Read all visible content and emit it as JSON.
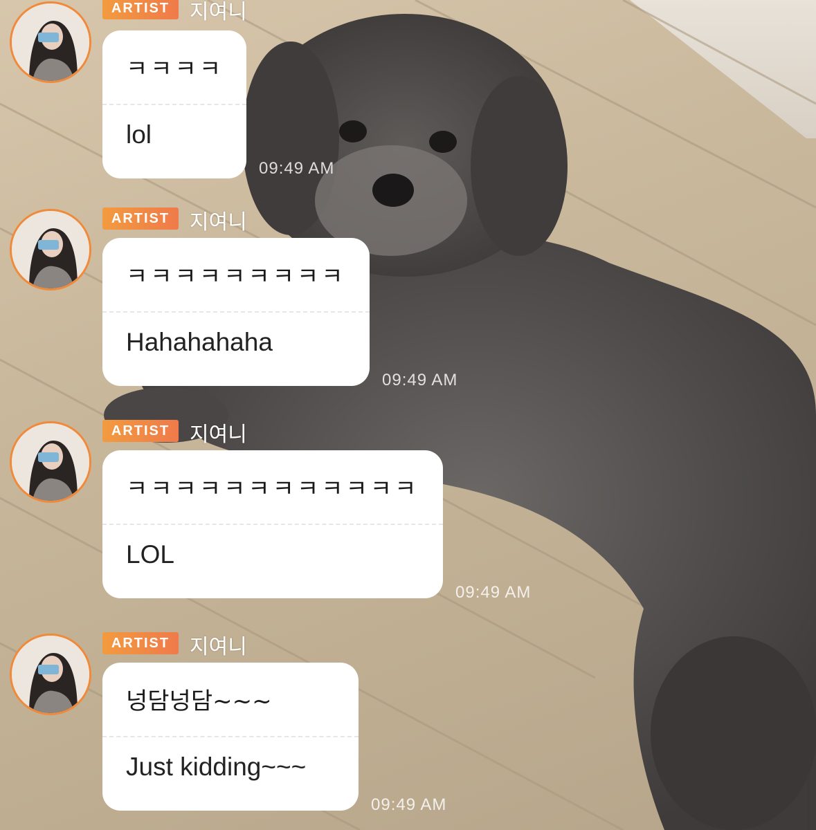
{
  "messages": [
    {
      "badge": "ARTIST",
      "sender": "지여니",
      "original": "ㅋㅋㅋㅋ",
      "translation": "lol",
      "time": "09:49 AM"
    },
    {
      "badge": "ARTIST",
      "sender": "지여니",
      "original": "ㅋㅋㅋㅋㅋㅋㅋㅋㅋ",
      "translation": "Hahahahaha",
      "time": "09:49 AM"
    },
    {
      "badge": "ARTIST",
      "sender": "지여니",
      "original": "ㅋㅋㅋㅋㅋㅋㅋㅋㅋㅋㅋㅋ",
      "translation": "LOL",
      "time": "09:49 AM"
    },
    {
      "badge": "ARTIST",
      "sender": "지여니",
      "original": "넝담넝담~~~",
      "translation": "Just kidding~~~",
      "time": "09:49 AM"
    }
  ],
  "colors": {
    "badge_start": "#f29b3f",
    "badge_end": "#ef7a4a",
    "avatar_ring": "#f08a3a",
    "bubble": "#ffffff"
  },
  "background": {
    "description_icon": "dog-photo"
  }
}
